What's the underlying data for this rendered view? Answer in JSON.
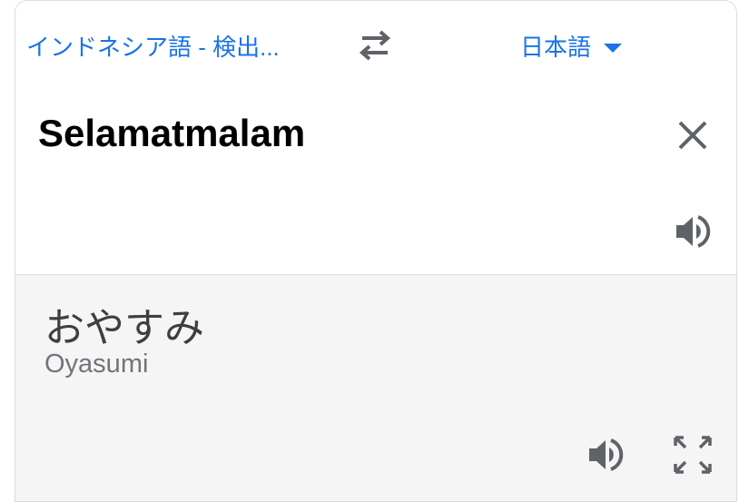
{
  "language_bar": {
    "source_language": "インドネシア語 - 検出...",
    "target_language": "日本語"
  },
  "input": {
    "text": "Selamatmalam"
  },
  "output": {
    "translation": "おやすみ",
    "romanization": "Oyasumi"
  },
  "icons": {
    "swap": "swap-languages-icon",
    "clear": "close-icon",
    "speak_source": "speaker-icon",
    "speak_target": "speaker-icon",
    "fullscreen": "fullscreen-icon",
    "dropdown": "chevron-down-icon"
  },
  "colors": {
    "accent": "#1a73e8",
    "icon": "#5f6368",
    "output_background": "#f5f5f5",
    "divider": "#dadce0"
  }
}
